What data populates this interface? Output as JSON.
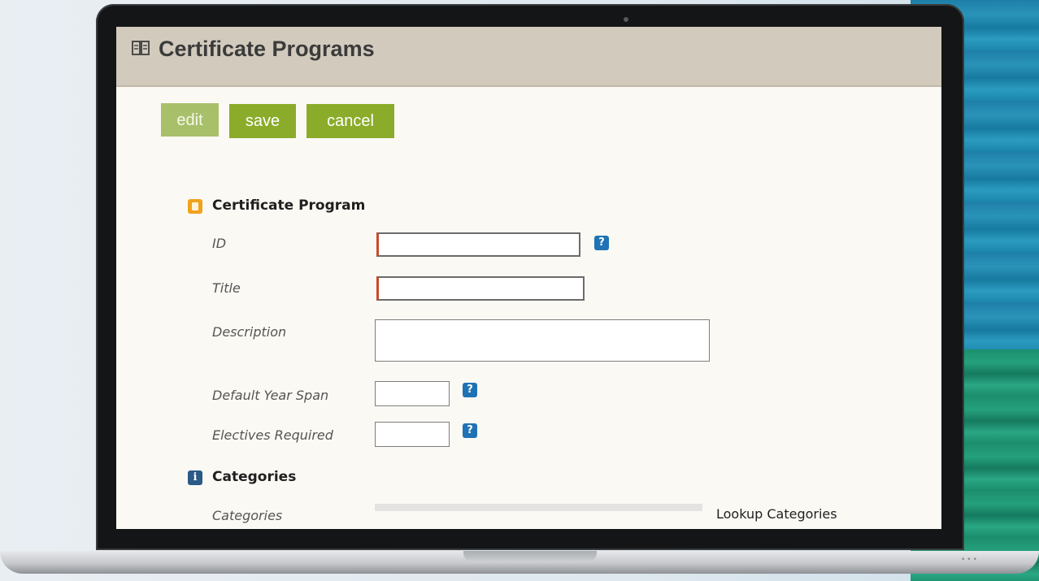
{
  "page": {
    "title": "Certificate Programs",
    "icon": "book-open-icon"
  },
  "toolbar": {
    "edit_label": "edit",
    "save_label": "save",
    "cancel_label": "cancel"
  },
  "sections": {
    "program": {
      "title": "Certificate Program",
      "icon": "document-icon",
      "fields": {
        "id_label": "ID",
        "id_value": "",
        "title_label": "Title",
        "title_value": "",
        "description_label": "Description",
        "description_value": "",
        "year_span_label": "Default Year Span",
        "year_span_value": "",
        "electives_label": "Electives Required",
        "electives_value": ""
      },
      "help_glyph": "?"
    },
    "categories": {
      "title": "Categories",
      "icon": "info-icon",
      "info_glyph": "i",
      "field_label": "Categories",
      "lookup_label": "Lookup Categories"
    }
  },
  "colors": {
    "button_green": "#8bac2a",
    "button_disabled": "#a8c06a",
    "title_bar": "#d2cbbd",
    "required_marker": "#c94a2c",
    "help_blue": "#1f73b5"
  }
}
